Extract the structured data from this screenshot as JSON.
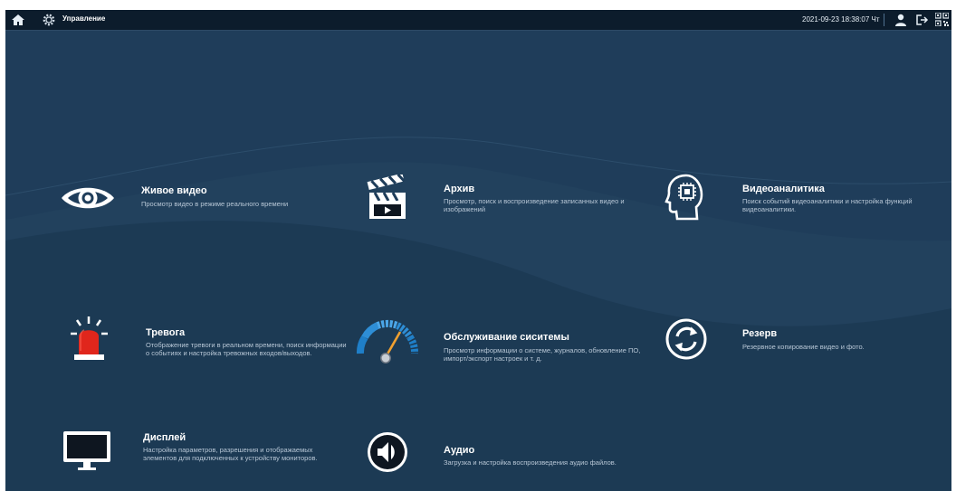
{
  "topbar": {
    "home_icon": "home-icon",
    "settings_icon": "gear-icon",
    "title": "Управление",
    "datetime": "2021-09-23 18:38:07 Чт",
    "user_icon": "user-icon",
    "logout_icon": "logout-icon",
    "qr_icon": "qr-code-icon"
  },
  "colors": {
    "background": "#1f3d5a",
    "topbar": "#0c1c2c",
    "alarm_red": "#e0261c",
    "gauge_blue": "#2e8ed6",
    "gauge_needle": "#f0a030"
  },
  "tiles": [
    {
      "icon": "eye-icon",
      "title": "Живое видео",
      "desc": "Просмотр видео в режиме реального времени"
    },
    {
      "icon": "clapperboard-icon",
      "title": "Архив",
      "desc": "Просмотр, поиск и воспроизведение записанных видео и изображений"
    },
    {
      "icon": "brain-head-icon",
      "title": "Видеоаналитика",
      "desc": "Поиск событий видеоаналитики и настройка функций видеоаналитики."
    },
    {
      "icon": "alarm-siren-icon",
      "title": "Тревога",
      "desc": "Отображение тревоги в реальном времени, поиск информации о событиях и настройка тревожных входов/выходов."
    },
    {
      "icon": "gauge-icon",
      "title": "Обслуживание сиситемы",
      "desc": "Просмотр информации о системе, журналов, обновление ПО, импорт/экспорт настроек и т. д."
    },
    {
      "icon": "backup-sync-icon",
      "title": "Резерв",
      "desc": "Резервное копирование видео и фото."
    },
    {
      "icon": "monitor-icon",
      "title": "Дисплей",
      "desc": "Настройка параметров, разрешения и отображаемых элементов для подключенных к устройству мониторов."
    },
    {
      "icon": "speaker-icon",
      "title": "Аудио",
      "desc": "Загрузка и настройка воспроизведения аудио файлов."
    }
  ]
}
